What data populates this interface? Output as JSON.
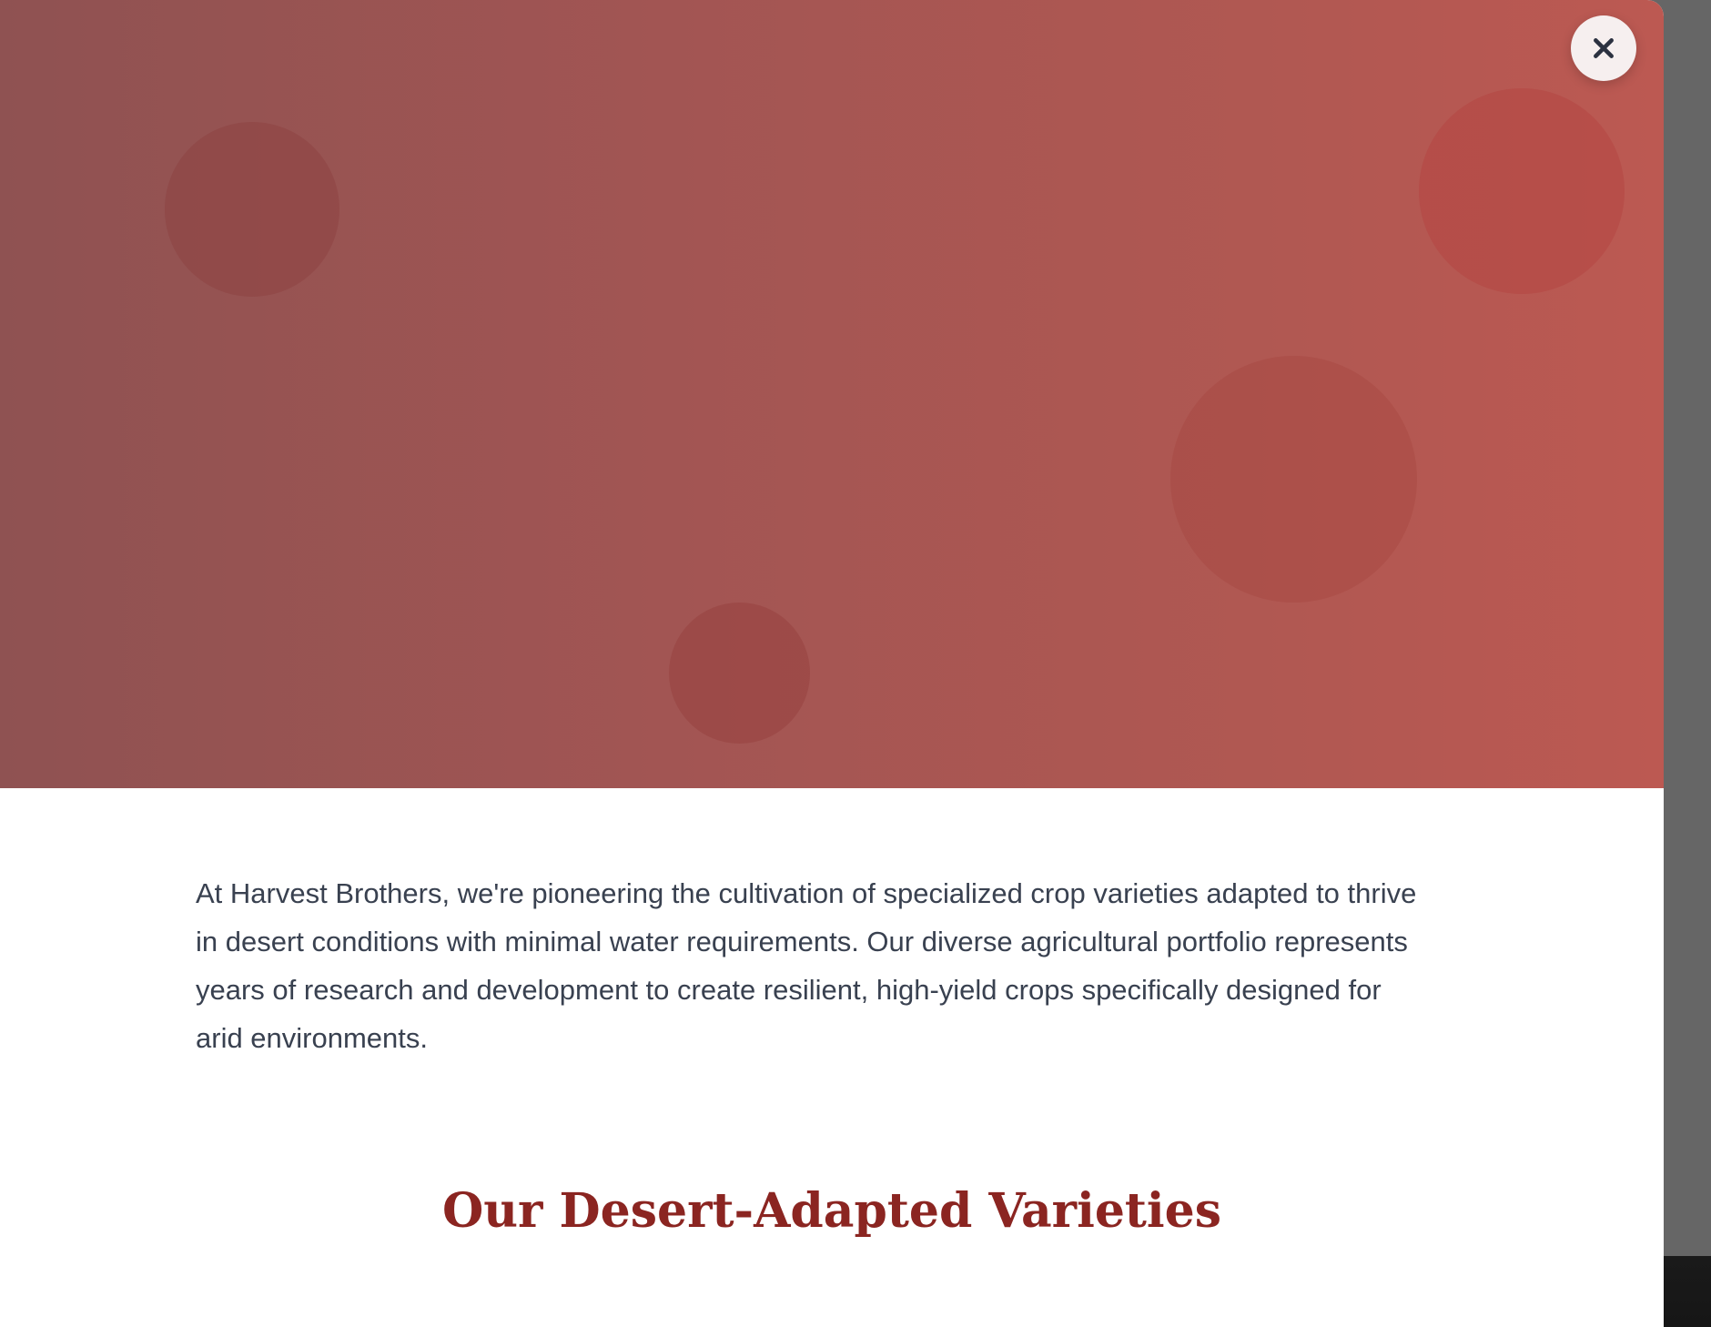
{
  "modal": {
    "close_label": "×",
    "intro_text": "At Harvest Brothers, we're pioneering the cultivation of specialized crop varieties adapted to thrive in desert conditions with minimal water requirements. Our diverse agricultural portfolio represents years of research and development to create resilient, high-yield crops specifically designed for arid environments.",
    "section_title": "Our Desert-Adapted Varieties"
  },
  "icons": {
    "close": "close-icon"
  },
  "colors": {
    "hero_gradient_start": "#8f5252",
    "hero_gradient_end": "#bc5952",
    "title": "#8b2521",
    "body_text": "#394150",
    "close_button_bg": "#f6efef",
    "overlay": "#666666"
  }
}
